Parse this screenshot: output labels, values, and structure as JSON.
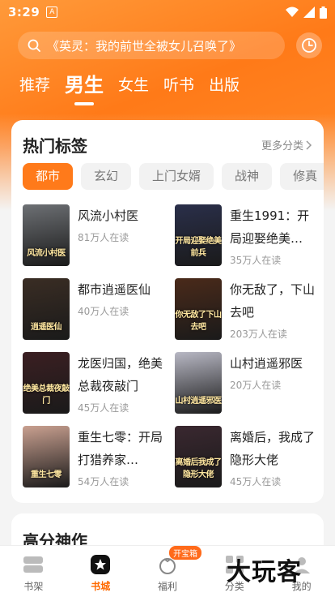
{
  "statusbar": {
    "time": "3:29",
    "app_badge": "A"
  },
  "search": {
    "placeholder": "《英灵：我的前世全被女儿召唤了》"
  },
  "topnav": [
    "推荐",
    "男生",
    "女生",
    "听书",
    "出版"
  ],
  "hot_tags": {
    "title": "热门标签",
    "more": "更多分类",
    "tags": [
      "都市",
      "玄幻",
      "上门女婿",
      "战神",
      "修真"
    ],
    "books": [
      {
        "title": "风流小村医",
        "readers": "81万人在读",
        "cover_text": "风流小村医",
        "color": "#6d7074"
      },
      {
        "title": "重生1991：开局迎娶绝美…",
        "readers": "35万人在读",
        "cover_text": "开局迎娶绝美前兵",
        "color": "#2a2f4a"
      },
      {
        "title": "都市逍遥医仙",
        "readers": "40万人在读",
        "cover_text": "逍遥医仙",
        "color": "#3a2d24"
      },
      {
        "title": "你无敌了，下山去吧",
        "readers": "203万人在读",
        "cover_text": "你无敌了下山去吧",
        "color": "#4a2a1a"
      },
      {
        "title": "龙医归国，绝美总裁夜敲门",
        "readers": "45万人在读",
        "cover_text": "绝美总裁夜敲门",
        "color": "#3b1f22"
      },
      {
        "title": "山村逍遥邪医",
        "readers": "20万人在读",
        "cover_text": "山村逍遥邪医",
        "color": "#b8b8c4"
      },
      {
        "title": "重生七零：开局打猎养家…",
        "readers": "54万人在读",
        "cover_text": "重生七零",
        "color": "#c9a090"
      },
      {
        "title": "离婚后，我成了隐形大佬",
        "readers": "45万人在读",
        "cover_text": "离婚后我成了隐形大佬",
        "color": "#3a2830"
      }
    ]
  },
  "high_score": {
    "title": "高分神作"
  },
  "tabbar": [
    {
      "label": "书架",
      "icon": "bookshelf-icon"
    },
    {
      "label": "书城",
      "icon": "star-icon"
    },
    {
      "label": "福利",
      "icon": "gift-icon",
      "badge": "开宝箱"
    },
    {
      "label": "分类",
      "icon": "grid-icon"
    },
    {
      "label": "我的",
      "icon": "user-icon"
    }
  ],
  "watermark": "大玩客",
  "colors": {
    "accent": "#ff7a1a",
    "hero": "#ff8a2a"
  }
}
